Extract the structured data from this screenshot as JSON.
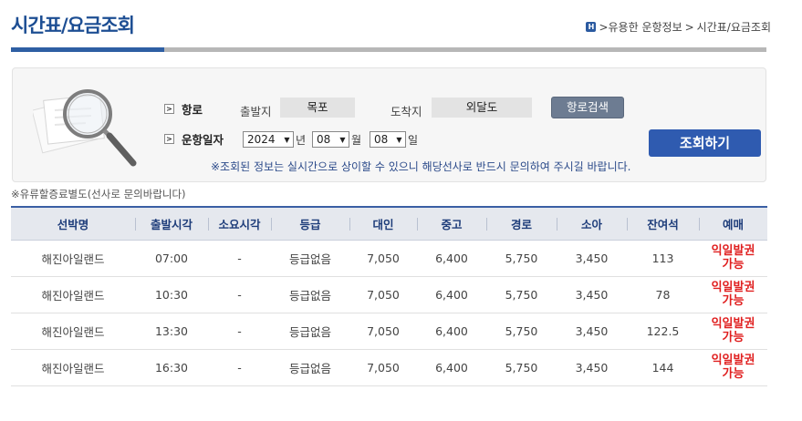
{
  "page": {
    "title": "시간표/요금조회",
    "breadcrumb": [
      ">유용한 운항정보",
      ">",
      "시간표/요금조회"
    ]
  },
  "search": {
    "route_label": "항로",
    "date_label": "운항일자",
    "depart_label": "출발지",
    "depart_value": "목포",
    "arrive_label": "도착지",
    "arrive_value": "외달도",
    "route_search_button": "항로검색",
    "year": "2024",
    "year_unit": "년",
    "month": "08",
    "month_unit": "월",
    "day": "08",
    "day_unit": "일",
    "query_button": "조회하기",
    "notice": "※조회된 정보는 실시간으로 상이할 수 있으니 해당선사로 반드시 문의하여 주시길 바랍니다."
  },
  "fee_note": "※유류할증료별도(선사로 문의바랍니다)",
  "table": {
    "headers": [
      "선박명",
      "출발시각",
      "소요시각",
      "등급",
      "대인",
      "중고",
      "경로",
      "소아",
      "잔여석",
      "예매"
    ],
    "rows": [
      [
        "해진아일랜드",
        "07:00",
        "-",
        "등급없음",
        "7,050",
        "6,400",
        "5,750",
        "3,450",
        "113",
        "익일발권 가능"
      ],
      [
        "해진아일랜드",
        "10:30",
        "-",
        "등급없음",
        "7,050",
        "6,400",
        "5,750",
        "3,450",
        "78",
        "익일발권 가능"
      ],
      [
        "해진아일랜드",
        "13:30",
        "-",
        "등급없음",
        "7,050",
        "6,400",
        "5,750",
        "3,450",
        "122.5",
        "익일발권 가능"
      ],
      [
        "해진아일랜드",
        "16:30",
        "-",
        "등급없음",
        "7,050",
        "6,400",
        "5,750",
        "3,450",
        "144",
        "익일발권 가능"
      ]
    ]
  },
  "colors": {
    "accent": "#2e5fa3",
    "query_button": "#2f5bb0",
    "booking_text": "#e02020"
  },
  "icons": [
    "home-icon",
    "chevron-right-icon",
    "magnifier-icon",
    "dropdown-caret-icon"
  ]
}
